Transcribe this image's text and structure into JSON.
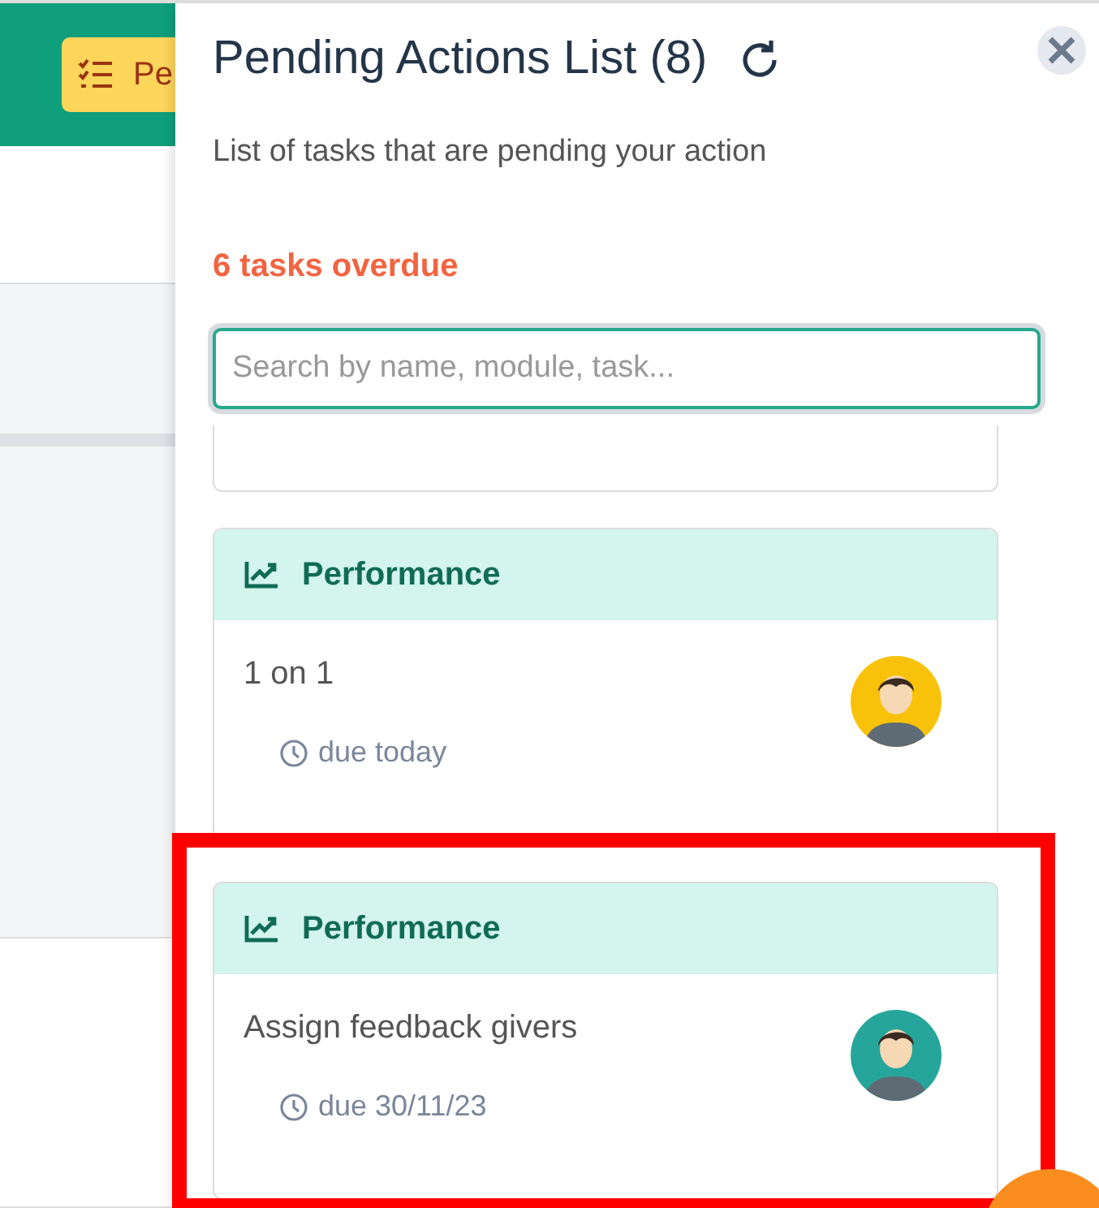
{
  "background": {
    "header_button": {
      "label": "Pe"
    }
  },
  "panel": {
    "title": "Pending Actions List (8)",
    "subtitle": "List of tasks that are pending your action",
    "overdue": "6 tasks overdue",
    "search": {
      "placeholder": "Search by name, module, task..."
    },
    "tasks": [
      {
        "module": "Performance",
        "name": "1 on 1",
        "due": "due today",
        "color": "#f9c20a",
        "highlighted": false
      },
      {
        "module": "Performance",
        "name": "Assign feedback givers",
        "due": "due 30/11/23",
        "color": "#26a69a",
        "highlighted": true
      }
    ]
  }
}
